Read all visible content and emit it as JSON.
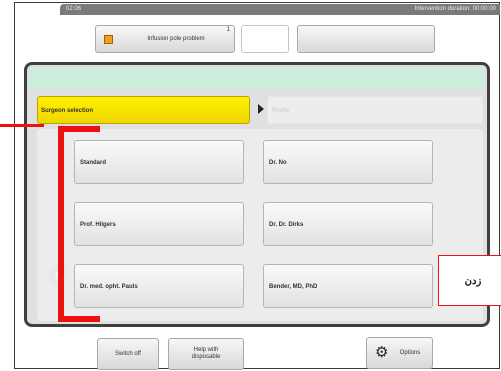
{
  "status_bar": {
    "time": "02:06",
    "duration": "Intervention duration: 00:00:00"
  },
  "alarm": {
    "label": "Infusion pole problem",
    "count": "1",
    "color": "#f0a020"
  },
  "tabs": {
    "active": "Surgeon selection",
    "inactive": "Profile"
  },
  "surgeons": [
    "Standard",
    "Dr. No",
    "Prof. Hilgers",
    "Dr. Dr. Dirks",
    "Dr. med. opht. Pauls",
    "Bender, MD, PhD"
  ],
  "nav": {
    "prev_icon": "chevron-left-icon",
    "next_icon": "arrow-right-icon"
  },
  "bottom": {
    "switch_off": "Switch off",
    "help_line1": "Help with",
    "help_line2": "disposable",
    "options": "Options",
    "options_icon": "gear-icon"
  },
  "annotation": {
    "callout_text": "زدن",
    "color": "#ee1111"
  },
  "colors": {
    "tab_active": "#fff000",
    "panel_header": "#cdeedd"
  }
}
